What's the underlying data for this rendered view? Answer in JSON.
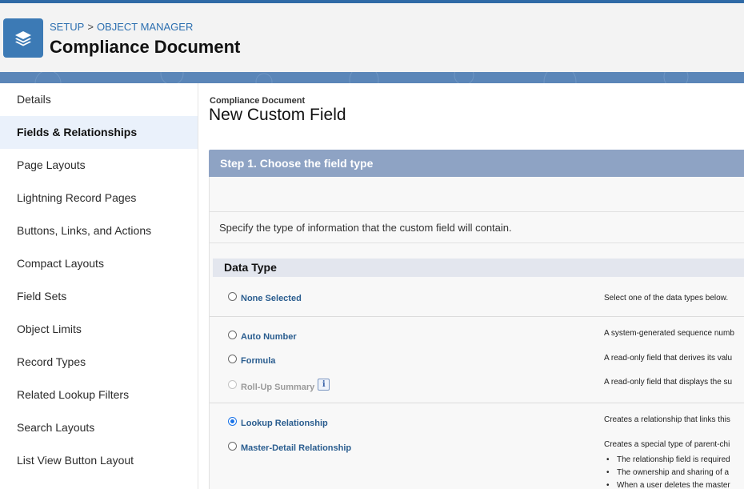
{
  "header": {
    "breadcrumb_setup": "SETUP",
    "breadcrumb_sep": ">",
    "breadcrumb_object_manager": "OBJECT MANAGER",
    "object_title": "Compliance Document",
    "icon": "layers-icon"
  },
  "sidebar": {
    "items": [
      {
        "label": "Details"
      },
      {
        "label": "Fields & Relationships"
      },
      {
        "label": "Page Layouts"
      },
      {
        "label": "Lightning Record Pages"
      },
      {
        "label": "Buttons, Links, and Actions"
      },
      {
        "label": "Compact Layouts"
      },
      {
        "label": "Field Sets"
      },
      {
        "label": "Object Limits"
      },
      {
        "label": "Record Types"
      },
      {
        "label": "Related Lookup Filters"
      },
      {
        "label": "Search Layouts"
      },
      {
        "label": "List View Button Layout"
      }
    ],
    "active_index": 1
  },
  "main": {
    "pre_title": "Compliance Document",
    "title": "New Custom Field",
    "step_title": "Step 1. Choose the field type",
    "instruction": "Specify the type of information that the custom field will contain.",
    "data_type_header": "Data Type",
    "options": [
      {
        "label": "None Selected",
        "desc": "Select one of the data types below.",
        "checked": false,
        "disabled": false
      },
      {
        "label": "Auto Number",
        "desc": "A system-generated sequence numb",
        "checked": false,
        "disabled": false
      },
      {
        "label": "Formula",
        "desc": "A read-only field that derives its valu",
        "checked": false,
        "disabled": false
      },
      {
        "label": "Roll-Up Summary",
        "desc": "A read-only field that displays the su",
        "checked": false,
        "disabled": true
      },
      {
        "label": "Lookup Relationship",
        "desc": "Creates a relationship that links this",
        "checked": true,
        "disabled": false
      },
      {
        "label": "Master-Detail Relationship",
        "desc": "Creates a special type of parent-chi",
        "checked": false,
        "disabled": false
      }
    ],
    "master_detail_bullets": [
      "The relationship field is required",
      "The ownership and sharing of a",
      "When a user deletes the master"
    ],
    "info_icon_glyph": "i"
  },
  "colors": {
    "topbar": "#2f6aa6",
    "object_icon": "#3c7ab5",
    "band": "#5b86b8",
    "step_bar": "#8ea3c4",
    "link": "#2a5d8f",
    "active_sidebar": "#eaf1fb"
  }
}
